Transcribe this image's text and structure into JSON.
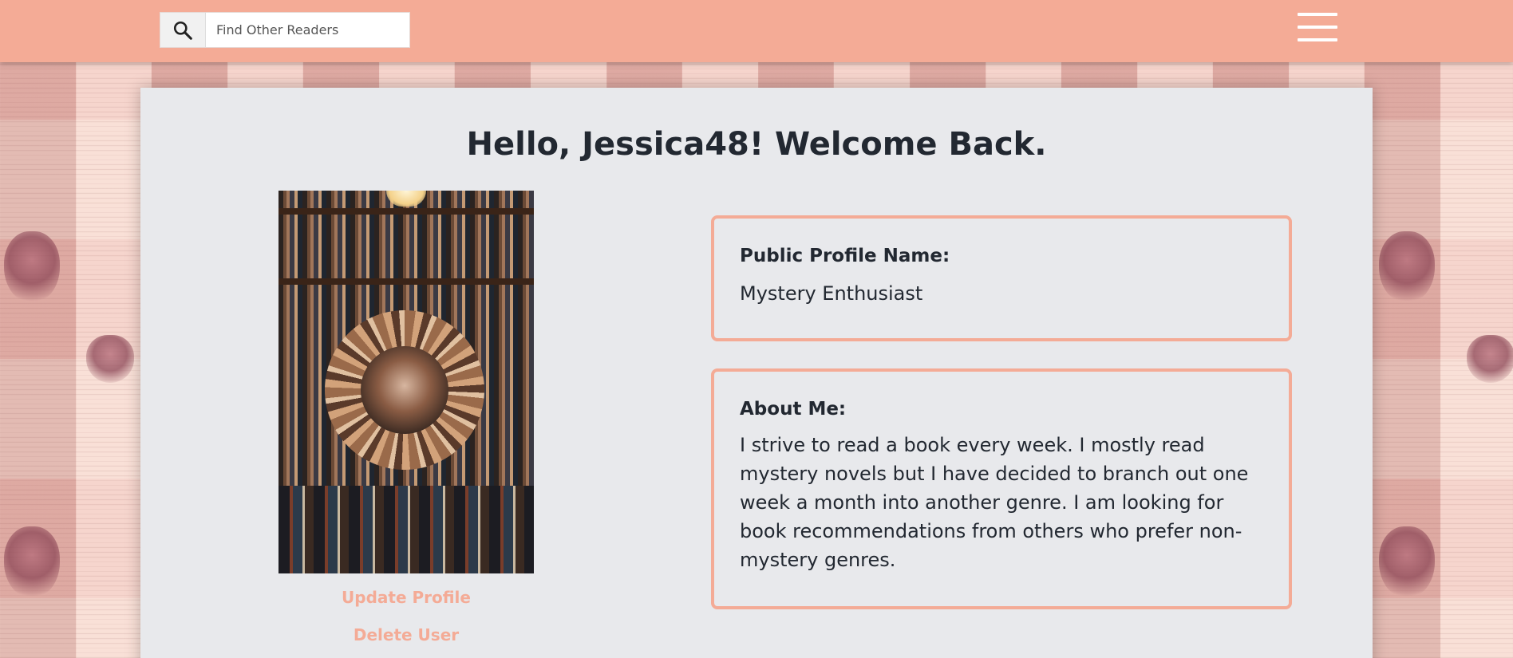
{
  "search": {
    "placeholder": "Find Other Readers"
  },
  "icons": {
    "search": "search-icon",
    "menu": "hamburger-menu-icon"
  },
  "colors": {
    "accent": "#f4ab96",
    "card_background": "#e8e9ec",
    "text": "#222831"
  },
  "main": {
    "greeting": "Hello, Jessica48! Welcome Back.",
    "profile_actions": {
      "update": "Update Profile",
      "delete": "Delete User"
    },
    "public_profile": {
      "label": "Public Profile Name:",
      "value": "Mystery Enthusiast"
    },
    "about": {
      "label": "About Me:",
      "value": "I strive to read a book every week. I mostly read mystery novels but I have decided to branch out one week a month into another genre. I am looking for book recommendations from others who prefer non-mystery genres."
    }
  }
}
